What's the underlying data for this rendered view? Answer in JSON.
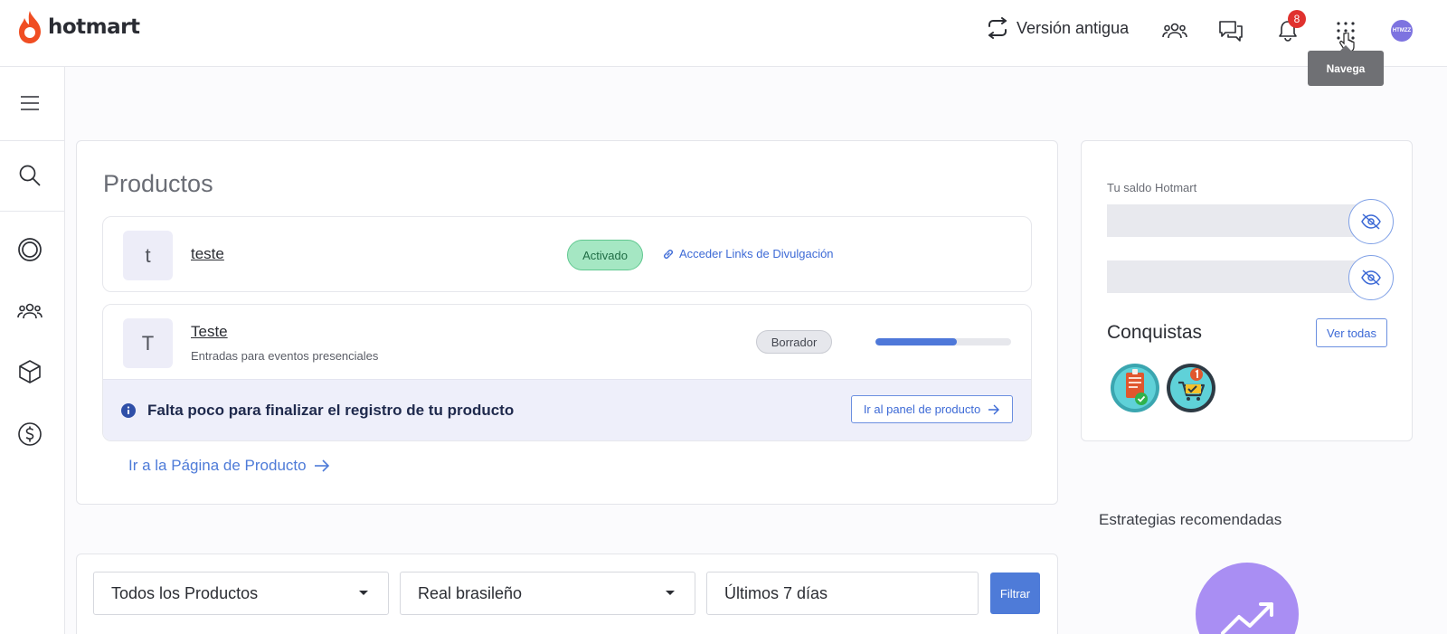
{
  "header": {
    "logo_text": "hotmart",
    "old_version_label": "Versión antigua",
    "notification_count": "8",
    "avatar_text": "HTMZZ",
    "tooltip": "Navega"
  },
  "sidebar": {
    "items": [
      {
        "icon": "menu-icon"
      },
      {
        "icon": "search-icon"
      },
      {
        "icon": "target-icon"
      },
      {
        "icon": "users-icon"
      },
      {
        "icon": "box-icon"
      },
      {
        "icon": "dollar-icon"
      }
    ]
  },
  "products": {
    "title": "Productos",
    "items": [
      {
        "thumb": "t",
        "name": "teste",
        "status": "Activado",
        "link_label": "Acceder Links de Divulgación"
      },
      {
        "thumb": "T",
        "name": "Teste",
        "subtitle": "Entradas para eventos presenciales",
        "status": "Borrador",
        "progress": 0.6,
        "alert": "Falta poco para finalizar el registro de tu producto",
        "alert_button": "Ir al panel de producto"
      }
    ],
    "page_link": "Ir a la Página de Producto"
  },
  "balance": {
    "label": "Tu saldo Hotmart"
  },
  "achievements": {
    "title": "Conquistas",
    "see_all": "Ver todas"
  },
  "strategies": {
    "title": "Estrategias recomendadas"
  },
  "filters": {
    "product_select": "Todos los Productos",
    "currency_select": "Real brasileño",
    "period_select": "Últimos 7 días",
    "filter_button": "Filtrar"
  },
  "colors": {
    "accent": "#4e7bd8",
    "brand": "#f04e23",
    "active": "#a5e7c3",
    "badge": "#e0322f"
  }
}
